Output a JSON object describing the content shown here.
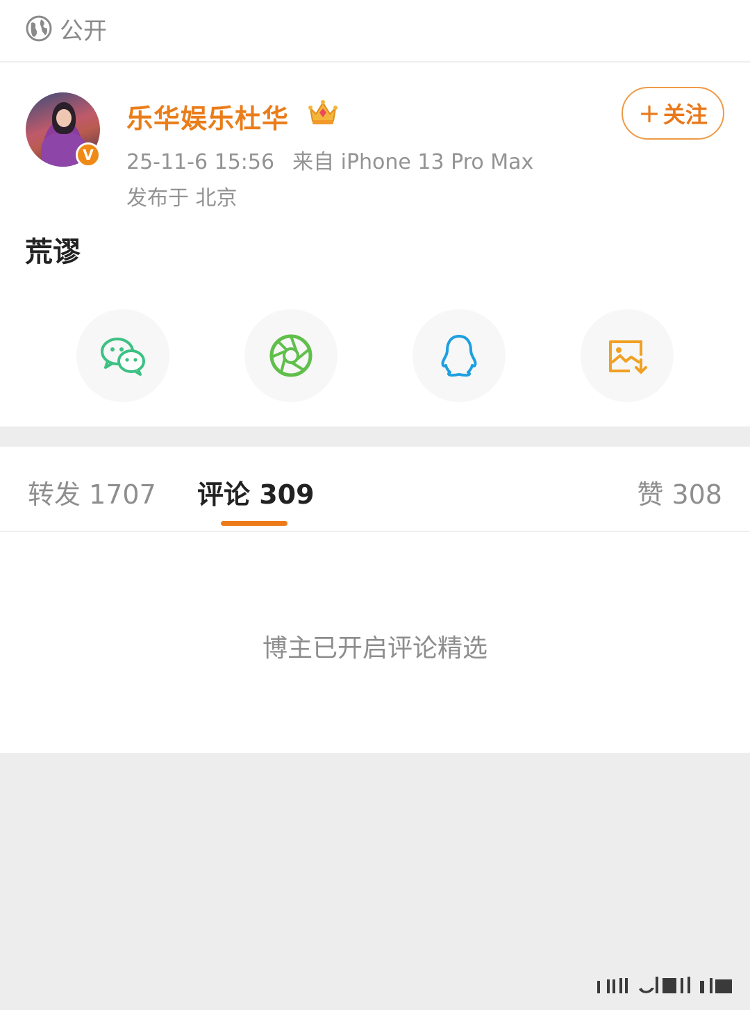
{
  "header": {
    "visibility_label": "公开",
    "visibility_icon": "globe-icon"
  },
  "post": {
    "author": "乐华娱乐杜华",
    "verified_badge_letter": "V",
    "timestamp": "25-11-6 15:56",
    "source": "来自 iPhone 13 Pro Max",
    "location": "发布于 北京",
    "follow_label": "关注",
    "content": "荒谬",
    "share_targets": [
      {
        "name": "wechat-icon",
        "color": "#3cc182"
      },
      {
        "name": "moments-icon",
        "color": "#5fbf4a"
      },
      {
        "name": "qq-icon",
        "color": "#1e9fe0"
      },
      {
        "name": "save-image-icon",
        "color": "#f0a022"
      }
    ]
  },
  "tabs": {
    "repost": "转发 1707",
    "comments": "评论 309",
    "likes": "赞 308",
    "active": "comments",
    "accent_color": "#ee7b1a"
  },
  "comments_panel": {
    "notice": "博主已开启评论精选"
  }
}
